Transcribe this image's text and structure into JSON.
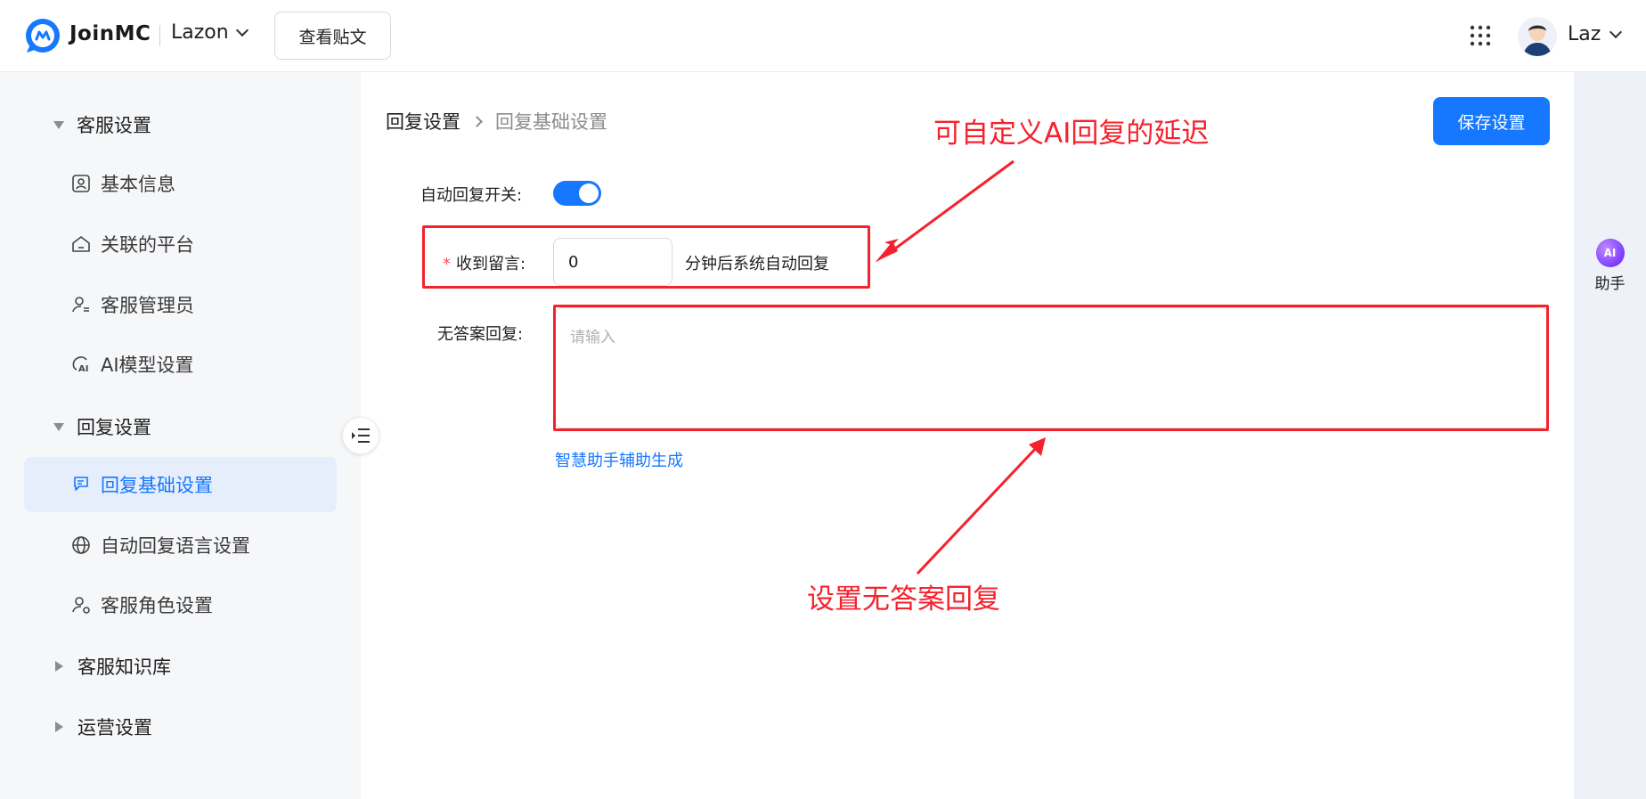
{
  "header": {
    "brand": "JoinMC",
    "workspace": "Lazon",
    "view_post_button": "查看贴文",
    "user_name": "Laz"
  },
  "sidebar": {
    "groups": [
      {
        "label": "客服设置",
        "expanded": true,
        "items": [
          {
            "label": "基本信息",
            "icon": "id-card-icon"
          },
          {
            "label": "关联的平台",
            "icon": "home-icon"
          },
          {
            "label": "客服管理员",
            "icon": "user-manage-icon"
          },
          {
            "label": "AI模型设置",
            "icon": "ai-model-icon"
          }
        ]
      },
      {
        "label": "回复设置",
        "expanded": true,
        "items": [
          {
            "label": "回复基础设置",
            "icon": "reply-icon",
            "active": true
          },
          {
            "label": "自动回复语言设置",
            "icon": "globe-icon"
          },
          {
            "label": "客服角色设置",
            "icon": "user-role-icon"
          }
        ]
      },
      {
        "label": "客服知识库",
        "expanded": false,
        "items": []
      },
      {
        "label": "运营设置",
        "expanded": false,
        "items": []
      }
    ]
  },
  "main": {
    "breadcrumb": [
      "回复设置",
      "回复基础设置"
    ],
    "save_button": "保存设置",
    "auto_reply_label": "自动回复开关:",
    "auto_reply_on": true,
    "message_label": "收到留言:",
    "message_required_mark": "*",
    "delay_value": "0",
    "delay_suffix": "分钟后系统自动回复",
    "no_answer_label": "无答案回复:",
    "no_answer_placeholder": "请输入",
    "assistant_generate_link": "智慧助手辅助生成"
  },
  "annotations": {
    "delay_note": "可自定义AI回复的延迟",
    "no_answer_note": "设置无答案回复",
    "color": "#f5222d"
  },
  "right_rail": {
    "assistant_badge": "AI",
    "assistant_label": "助手"
  },
  "colors": {
    "accent": "#1677ff",
    "sidebar_bg": "#f6f7f9",
    "active_bg": "#e6eefc"
  }
}
